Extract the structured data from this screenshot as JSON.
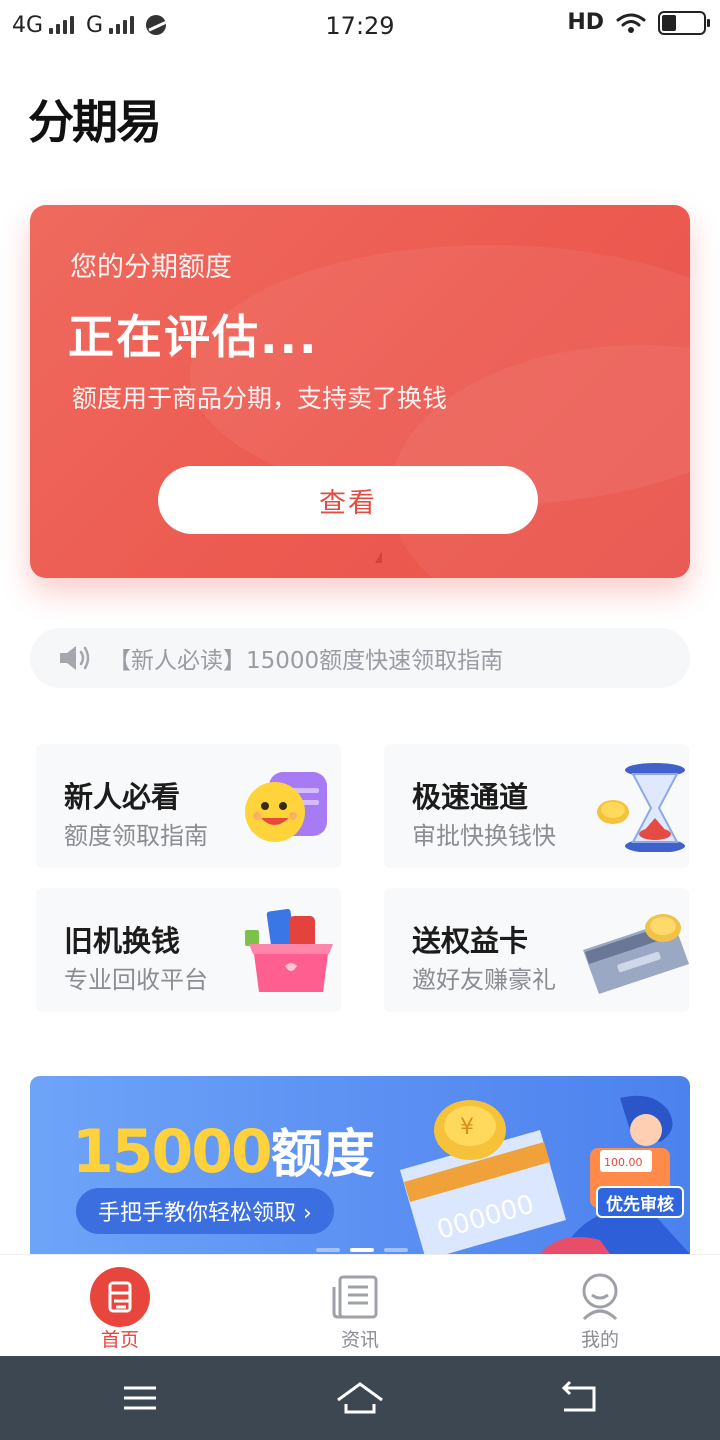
{
  "status_bar": {
    "network1": "4G",
    "network2": "G",
    "time": "17:29",
    "hd": "HD",
    "battery_level": 0.35
  },
  "app": {
    "logo_text": "分期易"
  },
  "credit": {
    "label": "您的分期额度",
    "status": "正在评估...",
    "description": "额度用于商品分期，支持卖了换钱",
    "button": "查看"
  },
  "notice": {
    "text": "【新人必读】15000额度快速领取指南",
    "icon": "speaker-icon"
  },
  "tiles": [
    {
      "title": "新人必看",
      "subtitle": "额度领取指南",
      "icon": "smile-face-icon"
    },
    {
      "title": "极速通道",
      "subtitle": "审批快换钱快",
      "icon": "hourglass-icon"
    },
    {
      "title": "旧机换钱",
      "subtitle": "专业回收平台",
      "icon": "gift-box-icon"
    },
    {
      "title": "送权益卡",
      "subtitle": "邀好友赚豪礼",
      "icon": "bank-card-icon"
    }
  ],
  "banner": {
    "amount": "15000",
    "amount_label": "额度",
    "button": "手把手教你轻松领取 ›",
    "badge": "优先审核",
    "card_number": "000000",
    "bill_text": "100.00",
    "active_slide": 2,
    "slide_count": 3
  },
  "bottom_nav": [
    {
      "label": "首页",
      "icon": "home-logo-icon",
      "active": true
    },
    {
      "label": "资讯",
      "icon": "news-icon",
      "active": false
    },
    {
      "label": "我的",
      "icon": "profile-icon",
      "active": false
    }
  ],
  "colors": {
    "accent": "#e8453c",
    "card_gradient_start": "#ef6a5e",
    "banner_blue": "#5b8ff2",
    "banner_yellow": "#ffd23c",
    "system_nav": "#3d4752"
  }
}
